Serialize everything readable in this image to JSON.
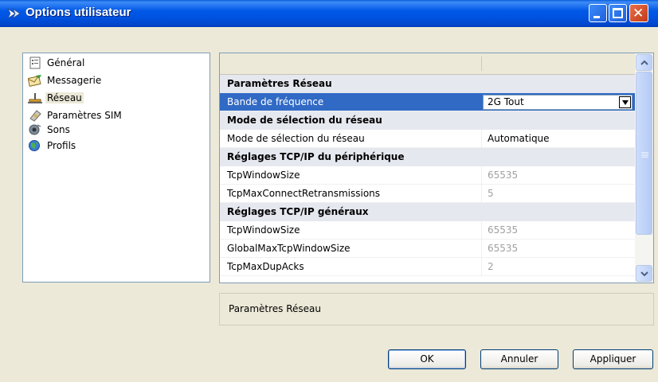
{
  "window": {
    "title": "Options utilisateur",
    "title_icon": "arrow-app-icon",
    "controls": {
      "minimize_icon": "minimize-icon",
      "maximize_icon": "maximize-icon",
      "close_icon": "close-icon",
      "close_glyph": "✕"
    }
  },
  "sidebar": {
    "items": [
      {
        "label": "Général",
        "icon": "general-icon",
        "selected": false
      },
      {
        "label": "Messagerie",
        "icon": "messaging-icon",
        "selected": false
      },
      {
        "label": "Réseau",
        "icon": "network-icon",
        "selected": true
      },
      {
        "label": "Paramètres SIM",
        "icon": "sim-settings-icon",
        "selected": false
      },
      {
        "label": "Sons",
        "icon": "sounds-icon",
        "selected": false
      },
      {
        "label": "Profils",
        "icon": "profiles-icon",
        "selected": false
      }
    ]
  },
  "grid": {
    "rows": [
      {
        "kind": "category",
        "name": "Paramètres Réseau"
      },
      {
        "kind": "property",
        "name": "Bande de fréquence",
        "value": "2G Tout",
        "selected": true,
        "dropdown": true
      },
      {
        "kind": "category",
        "name": "Mode de sélection du réseau"
      },
      {
        "kind": "property",
        "name": "Mode de sélection du réseau",
        "value": "Automatique",
        "disabled": false
      },
      {
        "kind": "category",
        "name": "Réglages TCP/IP du périphérique"
      },
      {
        "kind": "property",
        "name": "TcpWindowSize",
        "value": "65535",
        "disabled": true
      },
      {
        "kind": "property",
        "name": "TcpMaxConnectRetransmissions",
        "value": "5",
        "disabled": true
      },
      {
        "kind": "category",
        "name": "Réglages TCP/IP généraux"
      },
      {
        "kind": "property",
        "name": "TcpWindowSize",
        "value": "65535",
        "disabled": true
      },
      {
        "kind": "property",
        "name": "GlobalMaxTcpWindowSize",
        "value": "65535",
        "disabled": true
      },
      {
        "kind": "property",
        "name": "TcpMaxDupAcks",
        "value": "2",
        "disabled": true
      }
    ]
  },
  "description": {
    "text": "Paramètres Réseau"
  },
  "buttons": {
    "ok": "OK",
    "cancel": "Annuler",
    "apply": "Appliquer"
  },
  "colors": {
    "titlebar": "#0054E3",
    "selection": "#316AC5",
    "category_bg": "#E6E8F0",
    "disabled_text": "#A0A0A0",
    "window_bg": "#ECE9D8"
  }
}
